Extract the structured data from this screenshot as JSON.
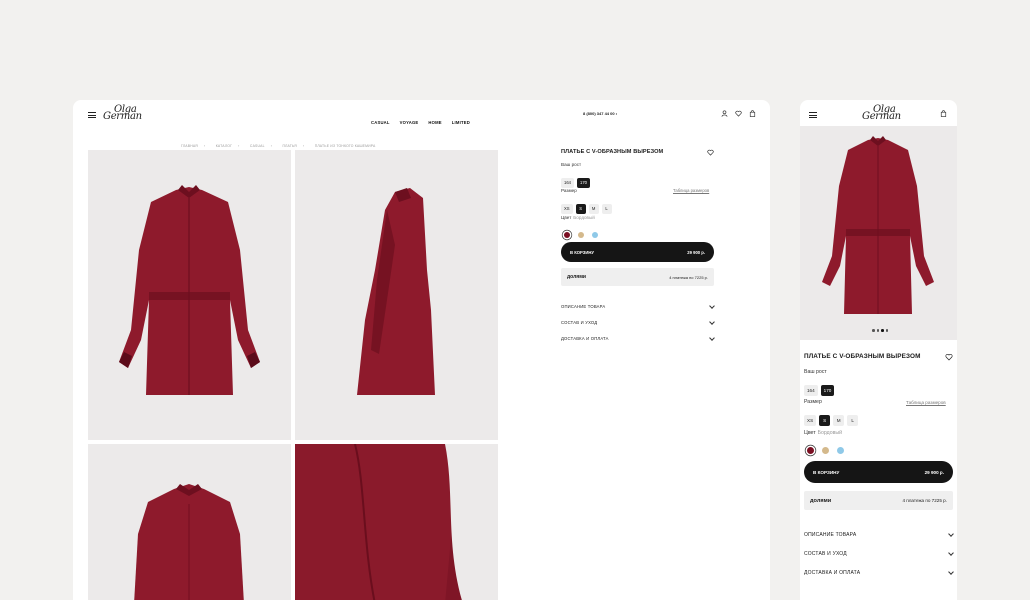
{
  "brand": {
    "logo_line1": "Olga",
    "logo_line2": "German"
  },
  "nav": [
    "CASUAL",
    "VOYAGE",
    "HOME",
    "LIMITED"
  ],
  "phone": "8 (800) 347 44 00 •",
  "breadcrumbs": [
    "ГЛАВНАЯ",
    "КАТАЛОГ",
    "CASUAL",
    "ПЛАТЬЯ",
    "ПЛАТЬЕ ИЗ ТОНКОГО КАШЕМИРА"
  ],
  "product": {
    "title": "ПЛАТЬЕ С V-ОБРАЗНЫМ ВЫРЕЗОМ",
    "height_label": "Ваш рост",
    "heights": [
      "164",
      "170"
    ],
    "height_selected": "170",
    "size_label": "Размер",
    "size_table_link": "Таблица размеров",
    "sizes": [
      "XS",
      "S",
      "M",
      "L"
    ],
    "size_selected": "S",
    "color_label": "Цвет",
    "color_name": "Бордовый",
    "colors": [
      "#7a0f22",
      "#d4b98c",
      "#8fc9e8"
    ],
    "cart_label": "В КОРЗИНУ",
    "price": "29 900 р.",
    "dolyami_label": "долями",
    "dolyami_terms": "4 платежа по 7225 р.",
    "accordion": [
      "ОПИСАНИЕ ТОВАРА",
      "СОСТАВ И УХОД",
      "ДОСТАВКА И ОПЛАТА"
    ]
  },
  "colors": {
    "shirt": "#8e1a2c",
    "shirt_dark": "#6d0f1f",
    "photo_bg": "#eceaea",
    "button": "#151515"
  },
  "icons": [
    "burger-icon",
    "user-icon",
    "heart-icon",
    "bag-icon",
    "chevron-down-icon"
  ]
}
